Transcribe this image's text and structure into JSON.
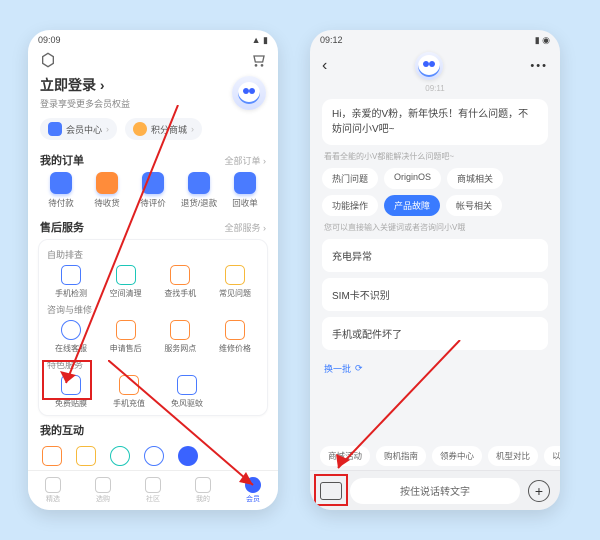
{
  "left": {
    "status_time": "09:09",
    "login_title": "立即登录",
    "login_sub": "登录享受更多会员权益",
    "pills": {
      "member": "会员中心",
      "points": "积分商城"
    },
    "orders": {
      "title": "我的订单",
      "more": "全部订单",
      "items": [
        "待付款",
        "待收货",
        "待评价",
        "退货/退款",
        "回收单"
      ]
    },
    "service": {
      "title": "售后服务",
      "more": "全部服务",
      "g1_title": "自助排查",
      "g1": [
        "手机检测",
        "空间清理",
        "查找手机",
        "常见问题"
      ],
      "g2_title": "咨询与维修",
      "g2": [
        "在线客服",
        "申请售后",
        "服务网点",
        "维修价格"
      ],
      "g3_title": "特色服务",
      "g3": [
        "免费贴膜",
        "手机充值",
        "免风驱蚊"
      ]
    },
    "interact_title": "我的互动",
    "nav": [
      "精选",
      "选购",
      "社区",
      "我的",
      "会员"
    ]
  },
  "right": {
    "status_time": "09:12",
    "time_stamp": "09:11",
    "greeting": "Hi，亲爱的V粉，新年快乐！有什么问题，不妨问问小V吧~",
    "hint1": "看看全能的小V都能解决什么问题吧~",
    "chips": [
      "热门问题",
      "OriginOS",
      "商城相关",
      "功能操作",
      "产品故障",
      "帐号相关"
    ],
    "active_chip": 4,
    "hint2": "您可以直接输入关键词或者咨询问小V哦",
    "list": [
      "充电异常",
      "SIM卡不识别",
      "手机或配件坏了"
    ],
    "refresh": "换一批",
    "bottom_chips": [
      "商城活动",
      "购机指南",
      "领券中心",
      "机型对比",
      "以旧"
    ],
    "voice_label": "按住说话转文字"
  }
}
